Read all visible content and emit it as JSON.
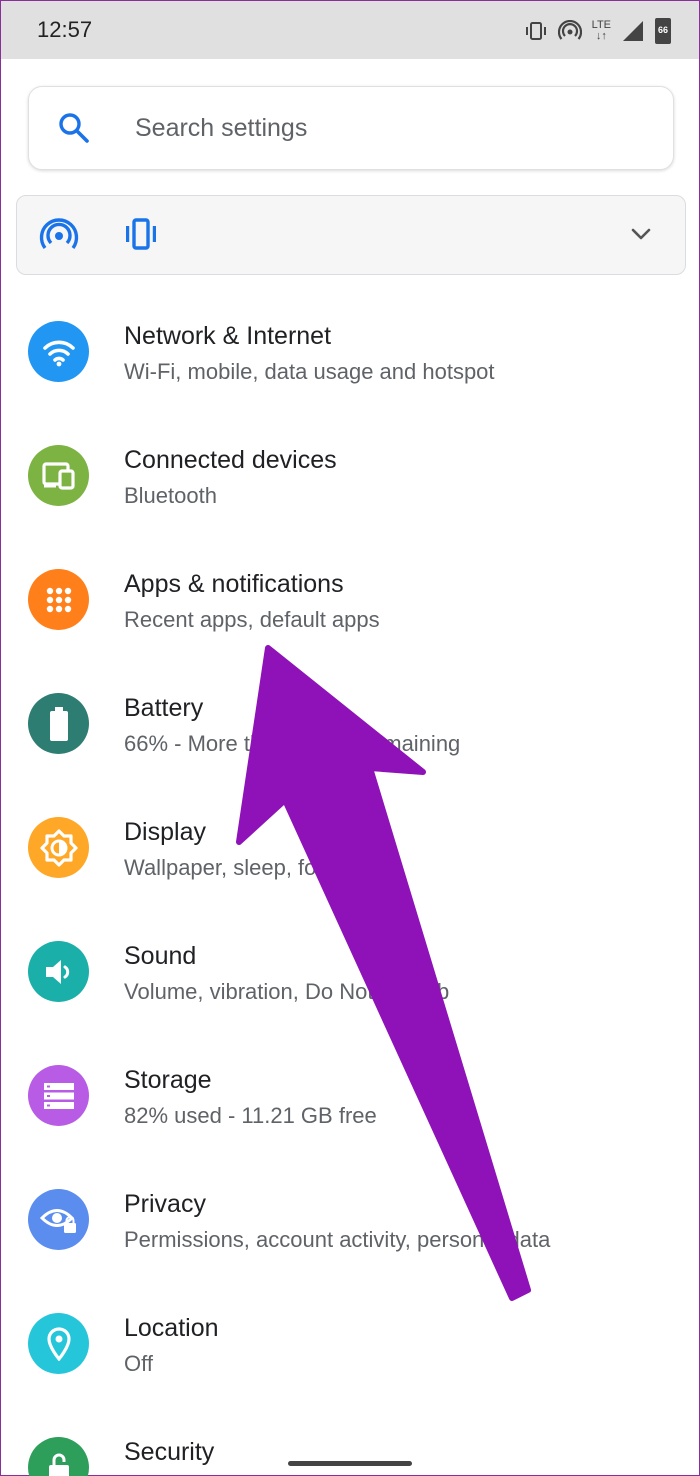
{
  "status_bar": {
    "time": "12:57",
    "network": "LTE",
    "battery": "66"
  },
  "search": {
    "placeholder": "Search settings"
  },
  "settings": [
    {
      "title": "Network & Internet",
      "subtitle": "Wi-Fi, mobile, data usage and hotspot",
      "icon": "wifi-icon",
      "color": "#2196f3"
    },
    {
      "title": "Connected devices",
      "subtitle": "Bluetooth",
      "icon": "devices-icon",
      "color": "#7cb342"
    },
    {
      "title": "Apps & notifications",
      "subtitle": "Recent apps, default apps",
      "icon": "apps-grid-icon",
      "color": "#ff7f1a"
    },
    {
      "title": "Battery",
      "subtitle": "66% - More than 2 days remaining",
      "icon": "battery-icon",
      "color": "#2e7d72"
    },
    {
      "title": "Display",
      "subtitle": "Wallpaper, sleep, font size",
      "icon": "brightness-icon",
      "color": "#ffa726"
    },
    {
      "title": "Sound",
      "subtitle": "Volume, vibration, Do Not Disturb",
      "icon": "volume-icon",
      "color": "#1aafa8"
    },
    {
      "title": "Storage",
      "subtitle": "82% used - 11.21 GB free",
      "icon": "storage-icon",
      "color": "#b85ce6"
    },
    {
      "title": "Privacy",
      "subtitle": "Permissions, account activity, personal data",
      "icon": "privacy-eye-icon",
      "color": "#5b8def"
    },
    {
      "title": "Location",
      "subtitle": "Off",
      "icon": "location-pin-icon",
      "color": "#26c6da"
    },
    {
      "title": "Security",
      "subtitle": "",
      "icon": "lock-icon",
      "color": "#2e9e5b"
    }
  ],
  "annotation": {
    "arrow_color": "#8e12b8"
  }
}
